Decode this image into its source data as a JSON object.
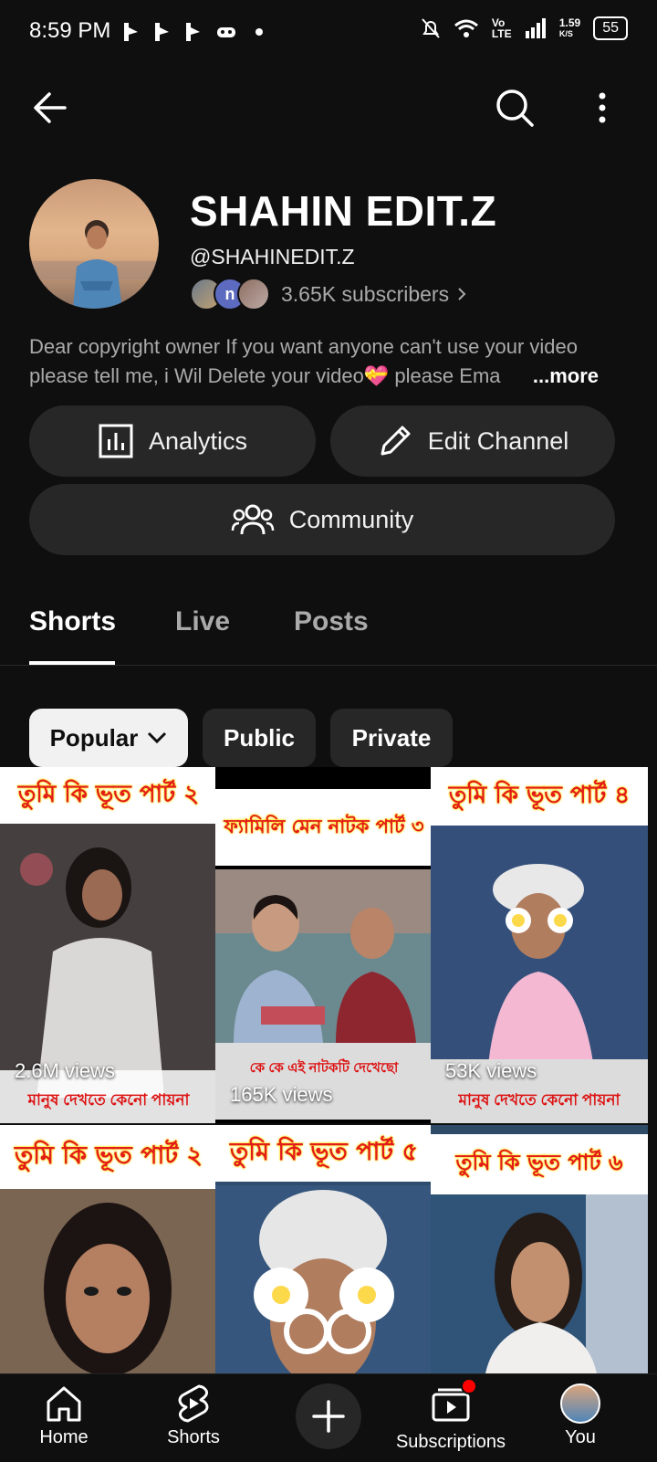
{
  "status_bar": {
    "time": "8:59 PM",
    "network_speed": "1.59",
    "network_unit": "K/S",
    "lte": "Vo LTE",
    "battery": "55"
  },
  "channel": {
    "name": "SHAHIN EDIT.Z",
    "handle": "@SHAHINEDIT.Z",
    "subscribers": "3.65K subscribers",
    "subscriber_avatar_letter": "n",
    "description": "Dear copyright owner If you want anyone can't use your video please tell me, i Wil Delete your video💝 please Ema",
    "more_label": "...more"
  },
  "actions": {
    "analytics": "Analytics",
    "edit_channel": "Edit Channel",
    "community": "Community"
  },
  "tabs": [
    {
      "label": "Shorts",
      "active": true
    },
    {
      "label": "Live",
      "active": false
    },
    {
      "label": "Posts",
      "active": false
    }
  ],
  "filters": [
    {
      "label": "Popular",
      "active": true
    },
    {
      "label": "Public",
      "active": false
    },
    {
      "label": "Private",
      "active": false
    }
  ],
  "shorts": [
    {
      "title": "তুমি কি ভূত পার্ট ২",
      "views": "2.6M views",
      "caption": "মানুষ দেখতে কেনো পায়না"
    },
    {
      "title": "ফ্যামিলি মেন নাটক পার্ট ৩",
      "views": "165K views",
      "caption": "কে কে এই নাটকটি দেখেছো"
    },
    {
      "title": "তুমি কি ভূত পার্ট ৪",
      "views": "53K views",
      "caption": "মানুষ দেখতে কেনো পায়না"
    },
    {
      "title": "তুমি কি ভূত পার্ট ২",
      "views": "",
      "caption": ""
    },
    {
      "title": "তুমি কি ভূত পার্ট ৫",
      "views": "",
      "caption": ""
    },
    {
      "title": "তুমি কি ভূত পার্ট ৬",
      "views": "",
      "caption": ""
    }
  ],
  "bottom_nav": {
    "home": "Home",
    "shorts": "Shorts",
    "subscriptions": "Subscriptions",
    "you": "You"
  },
  "colors": {
    "background": "#0f0f0f",
    "surface": "#272727",
    "secondary_text": "#aaaaaa",
    "notification_dot": "#ff0000",
    "title_red": "#e21b1b"
  }
}
